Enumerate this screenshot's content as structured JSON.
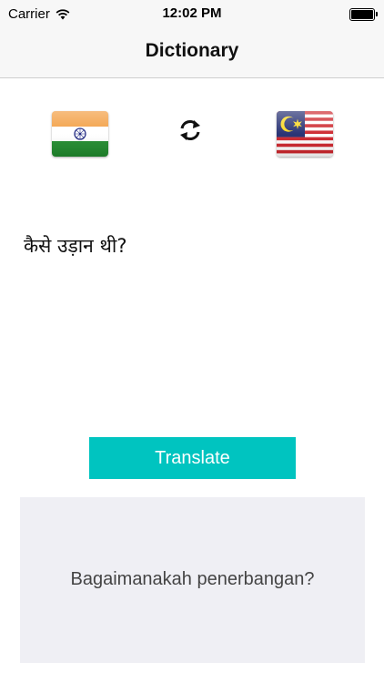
{
  "status_bar": {
    "carrier": "Carrier",
    "time": "12:02 PM"
  },
  "nav": {
    "title": "Dictionary"
  },
  "languages": {
    "source_flag": "india-flag",
    "target_flag": "malaysia-flag",
    "swap_icon": "swap-arrows-icon"
  },
  "input": {
    "text": "कैसे उड़ान थी?"
  },
  "translate_button": {
    "label": "Translate"
  },
  "result": {
    "text": "Bagaimanakah penerbangan?"
  },
  "colors": {
    "accent": "#00c4c0",
    "result_background": "#efeff4",
    "bar_background": "#f7f7f7"
  }
}
